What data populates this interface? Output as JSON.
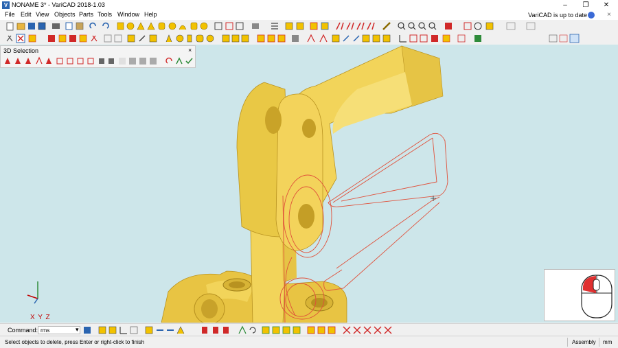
{
  "window": {
    "title": "NONAME 3* - VariCAD 2018-1.03",
    "app_icon_glyph": "V",
    "minimize_glyph": "–",
    "maximize_glyph": "❐",
    "close_glyph": "✕"
  },
  "menu": {
    "items": [
      "File",
      "Edit",
      "View",
      "Objects",
      "Parts",
      "Tools",
      "Window",
      "Help"
    ],
    "update_notice": "VariCAD is up to date",
    "close_glyph": "×"
  },
  "selection_panel": {
    "title": "3D Selection",
    "close_glyph": "×"
  },
  "viewport": {
    "axes_label": "X Y Z",
    "background": "#cde6ea",
    "part_color": "#f2d45a",
    "outline_color": "#e0503a"
  },
  "command": {
    "label": "Command:",
    "value": "rms",
    "dropdown_glyph": "▾"
  },
  "status": {
    "message": "Select objects to delete, press Enter or right-click to finish",
    "mode": "Assembly",
    "units": "mm"
  },
  "colors": {
    "toolbar_yellow": "#f2c200",
    "toolbar_red": "#d02828",
    "toolbar_blue": "#2a64b0",
    "toolbar_grey": "#7a7a7a"
  }
}
